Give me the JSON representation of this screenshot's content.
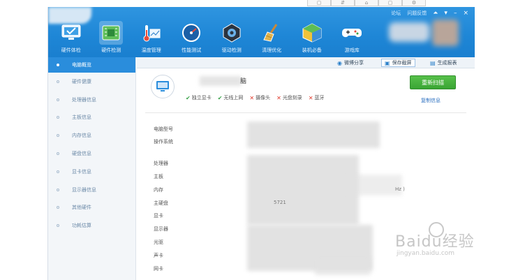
{
  "window_controls": {
    "forum": "论坛",
    "feedback": "问题反馈",
    "minimize": "–",
    "close": "×"
  },
  "toolbar": {
    "items": [
      {
        "label": "硬件体检",
        "icon": "monitor-check-icon"
      },
      {
        "label": "硬件检测",
        "icon": "circuit-board-icon"
      },
      {
        "label": "温度管理",
        "icon": "thermometer-icon"
      },
      {
        "label": "性能测试",
        "icon": "speedometer-icon"
      },
      {
        "label": "驱动检测",
        "icon": "driver-gear-icon"
      },
      {
        "label": "清理优化",
        "icon": "broom-icon"
      },
      {
        "label": "装机必备",
        "icon": "package-icon"
      },
      {
        "label": "游戏库",
        "icon": "gamepad-icon"
      }
    ],
    "active_index": 1
  },
  "sidebar": {
    "items": [
      {
        "label": "电脑概览"
      },
      {
        "label": "硬件健康"
      },
      {
        "label": "处理器信息"
      },
      {
        "label": "主板信息"
      },
      {
        "label": "内存信息"
      },
      {
        "label": "硬盘信息"
      },
      {
        "label": "显卡信息"
      },
      {
        "label": "显示器信息"
      },
      {
        "label": "其他硬件"
      },
      {
        "label": "功耗估算"
      }
    ],
    "active_index": 0
  },
  "subbar": {
    "share": "微博分享",
    "save_screenshot": "保存截屏",
    "report": "生成报表"
  },
  "overview": {
    "title_suffix": "脑",
    "features": [
      {
        "label": "独立显卡",
        "status": "ok"
      },
      {
        "label": "无线上网",
        "status": "ok"
      },
      {
        "label": "摄像头",
        "status": "no"
      },
      {
        "label": "光盘刻录",
        "status": "no"
      },
      {
        "label": "蓝牙",
        "status": "no"
      }
    ],
    "rescan_button": "重新扫描",
    "copy_info": "复制信息",
    "rows": {
      "model": "电脑型号",
      "os": "操作系统",
      "cpu": "处理器",
      "board": "主板",
      "memory": "内存",
      "disk": "主硬盘",
      "gpu": "显卡",
      "monitor": "显示器",
      "optical": "光驱",
      "sound": "声卡",
      "network": "网卡"
    },
    "fragments": {
      "memory_tail": "Hz )",
      "disk_head": "5721"
    }
  },
  "watermark": {
    "brand": "Baidu经验",
    "url": "jingyan.baidu.com"
  },
  "colors": {
    "accent": "#2a8ddc",
    "toolbar_bg": "#1e86d6",
    "ok": "#3aa34a",
    "no": "#e0392b",
    "rescan": "#3aa534"
  }
}
